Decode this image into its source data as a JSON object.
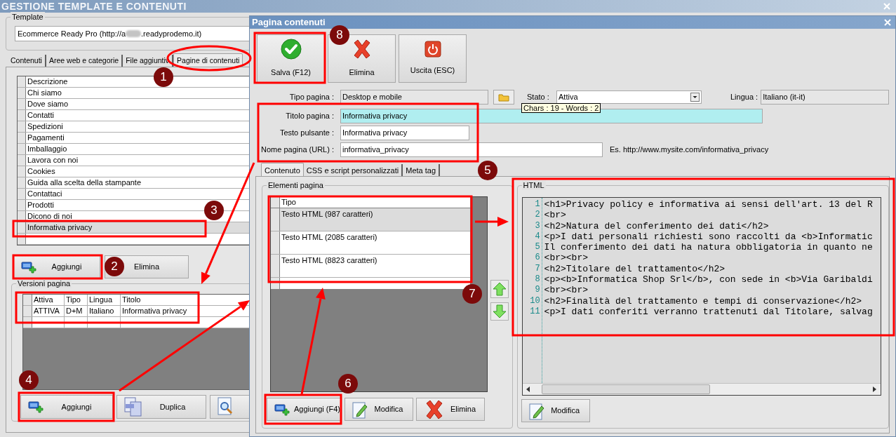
{
  "window": {
    "title": "GESTIONE TEMPLATE E CONTENUTI"
  },
  "template": {
    "legend": "Template",
    "value_start": "Ecommerce Ready Pro (http://a",
    "value_end": ".readyprodemo.it)"
  },
  "tabs": [
    {
      "label": "Contenuti",
      "selected": false
    },
    {
      "label": "Aree web e categorie",
      "selected": false
    },
    {
      "label": "File aggiuntiv",
      "selected": false
    },
    {
      "label": "Pagine di contenuti",
      "selected": true
    }
  ],
  "pages": {
    "column": "Descrizione",
    "rows": [
      {
        "label": "Chi siamo",
        "selected": false
      },
      {
        "label": "Dove siamo",
        "selected": false
      },
      {
        "label": "Contatti",
        "selected": false
      },
      {
        "label": "Spedizioni",
        "selected": false
      },
      {
        "label": "Pagamenti",
        "selected": false
      },
      {
        "label": "Imballaggio",
        "selected": false
      },
      {
        "label": "Lavora con noi",
        "selected": false
      },
      {
        "label": "Cookies",
        "selected": false
      },
      {
        "label": "Guida alla scelta della stampante",
        "selected": false
      },
      {
        "label": "Contattaci",
        "selected": false
      },
      {
        "label": "Prodotti",
        "selected": false
      },
      {
        "label": "Dicono di noi",
        "selected": false
      },
      {
        "label": "Informativa privacy",
        "selected": true
      }
    ]
  },
  "page_buttons": [
    {
      "label": "Aggiungi",
      "kind": "add"
    },
    {
      "label": "Elimina",
      "kind": "plain"
    }
  ],
  "versions": {
    "legend": "Versioni pagina",
    "columns": [
      "Attiva",
      "Tipo",
      "Lingua",
      "Titolo"
    ],
    "rows": [
      {
        "cells": [
          "ATTIVA",
          "D+M",
          "Italiano",
          "Informativa privacy"
        ]
      }
    ]
  },
  "version_buttons": [
    {
      "label": "Aggiungi",
      "kind": "add"
    },
    {
      "label": "Duplica",
      "kind": "duplicate"
    },
    {
      "kind": "preview"
    }
  ],
  "dialog": {
    "title": "Pagina contenuti",
    "toolbar": [
      {
        "label": "Salva (F12)",
        "kind": "save"
      },
      {
        "label": "Elimina",
        "kind": "delete"
      },
      {
        "label": "Uscita (ESC)",
        "kind": "exit"
      }
    ],
    "page_type": {
      "label": "Tipo pagina :",
      "value": "Desktop e mobile"
    },
    "status": {
      "label": "Stato :",
      "value": "Attiva"
    },
    "language": {
      "label": "Lingua :",
      "value": "Italiano (it-it)"
    },
    "tooltip": "Chars : 19 - Words : 2",
    "page_title": {
      "label": "Titolo pagina :",
      "value": "Informativa privacy"
    },
    "button_text": {
      "label": "Testo pulsante :",
      "value": "Informativa privacy"
    },
    "page_name": {
      "label": "Nome pagina (URL) :",
      "value": "informativa_privacy",
      "hint": "Es. http://www.mysite.com/informativa_privacy"
    },
    "tabs": [
      {
        "label": "Contenuto",
        "selected": true
      },
      {
        "label": "CSS e script personalizzati",
        "selected": false
      },
      {
        "label": "Meta tag",
        "selected": false
      }
    ],
    "elements": {
      "legend": "Elementi pagina",
      "column": "Tipo",
      "rows": [
        {
          "label": "Testo HTML (987 caratteri)",
          "selected": true
        },
        {
          "label": "Testo HTML (2085 caratteri)",
          "selected": false
        },
        {
          "label": "Testo HTML (8823 caratteri)",
          "selected": false
        }
      ]
    },
    "element_buttons": [
      {
        "label": "Aggiungi (F4)",
        "kind": "add"
      },
      {
        "label": "Modifica",
        "kind": "edit"
      },
      {
        "label": "Elimina",
        "kind": "delete"
      }
    ],
    "html": {
      "legend": "HTML",
      "lines": [
        {
          "number": "1",
          "code": "<h1>Privacy policy e informativa ai sensi dell'art. 13 del R"
        },
        {
          "number": "2",
          "code": "<br>"
        },
        {
          "number": "3",
          "code": "<h2>Natura del conferimento dei dati</h2>"
        },
        {
          "number": "4",
          "code": "<p>I dati personali richiesti sono raccolti da <b>Informatic"
        },
        {
          "number": "5",
          "code": "Il conferimento dei dati ha natura obbligatoria in quanto ne"
        },
        {
          "number": "6",
          "code": "<br><br>"
        },
        {
          "number": "7",
          "code": "<h2>Titolare del trattamento</h2>"
        },
        {
          "number": "8",
          "code": "<p><b>Informatica Shop Srl</b>, con sede in <b>Via Garibaldi"
        },
        {
          "number": "9",
          "code": "<br><br>"
        },
        {
          "number": "10",
          "code": "<h2>Finalità del trattamento e tempi di conservazione</h2>"
        },
        {
          "number": "11",
          "code": "<p>I dati conferiti verranno trattenuti dal Titolare, salvag"
        }
      ],
      "button": {
        "label": "Modifica",
        "kind": "edit"
      }
    }
  },
  "annotations": [
    "1",
    "2",
    "3",
    "4",
    "5",
    "6",
    "7",
    "8"
  ]
}
